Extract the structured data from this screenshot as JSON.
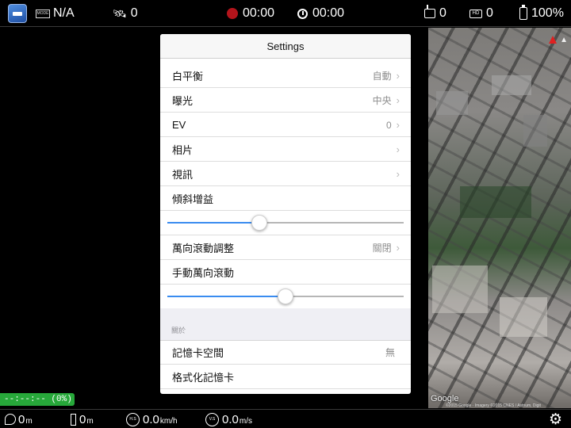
{
  "status_bar": {
    "mode": "N/A",
    "mode_box": "MODE",
    "satellites": "0",
    "record_time": "00:00",
    "timer": "00:00",
    "rc_signal": "0",
    "hd_signal": "0",
    "hd_box": "HD",
    "battery": "100%"
  },
  "settings": {
    "title": "Settings",
    "rows": [
      {
        "label": "白平衡",
        "value": "自動",
        "chevron": "›"
      },
      {
        "label": "曝光",
        "value": "中央",
        "chevron": "›"
      },
      {
        "label": "EV",
        "value": "0",
        "chevron": "›"
      },
      {
        "label": "相片",
        "value": "",
        "chevron": "›"
      },
      {
        "label": "視訊",
        "value": "",
        "chevron": "›"
      },
      {
        "label": "傾斜增益"
      },
      {
        "label": "萬向滾動調整",
        "value": "關閉",
        "chevron": "›"
      },
      {
        "label": "手動萬向滾動"
      }
    ],
    "sliders": {
      "tilt_gain": 0.39,
      "manual_roll": 0.5
    },
    "about_section": "關於",
    "about_rows": [
      {
        "label": "記憶卡空間",
        "value": "無"
      },
      {
        "label": "格式化記憶卡"
      }
    ]
  },
  "progress": {
    "text": "--:--:-- (0%)"
  },
  "map": {
    "brand": "Google",
    "attribution": "©2015 Google · Imagery ©2015 CNES / Astrium, Digit"
  },
  "bottom_bar": {
    "distance": "0",
    "distance_unit": "m",
    "height": "0",
    "height_unit": "m",
    "hspeed": "0.0",
    "hspeed_unit": "km/h",
    "hs_label": "H.S",
    "vspeed": "0.0",
    "vspeed_unit": "m/s",
    "vs_label": "V.S"
  },
  "colors": {
    "record": "#b3141b",
    "slider_accent": "#3a8cf0",
    "progress_bg": "#27a83a"
  },
  "icons": [
    "app-logo-icon",
    "satellite-icon",
    "record-icon",
    "clock-icon",
    "remote-controller-icon",
    "hd-signal-icon",
    "battery-icon",
    "distance-icon",
    "height-icon",
    "speed-icon",
    "gear-icon"
  ]
}
